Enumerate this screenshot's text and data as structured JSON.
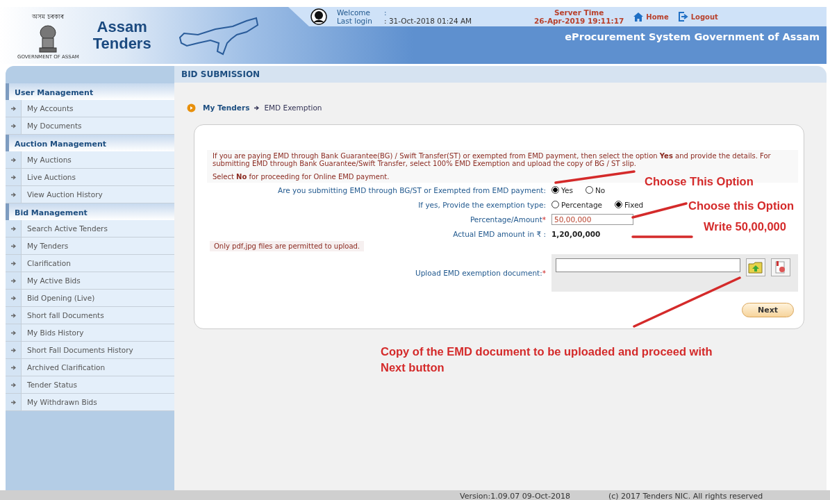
{
  "header": {
    "govt_script": "অসম চৰকাৰ",
    "govt_caption": "GOVERNMENT OF ASSAM",
    "site_title_lines": [
      "Assam",
      "Tenders"
    ],
    "welcome_label": "Welcome",
    "welcome_value": ":",
    "last_login_label": "Last login",
    "last_login_value": ": 31-Oct-2018 01:24 AM",
    "server_time_label": "Server Time",
    "server_time": "26-Apr-2019 19:11:17",
    "nav": [
      {
        "kind": "home",
        "label": "Home"
      },
      {
        "kind": "logout",
        "label": "Logout"
      }
    ],
    "system_title": "eProcurement System Government of Assam"
  },
  "sidebar": {
    "sections": [
      {
        "title": "User Management",
        "items": [
          "My Accounts",
          "My Documents"
        ]
      },
      {
        "title": "Auction Management",
        "items": [
          "My Auctions",
          "Live Auctions",
          "View Auction History"
        ]
      },
      {
        "title": "Bid Management",
        "items": [
          "Search Active Tenders",
          "My Tenders",
          "Clarification",
          "My Active Bids",
          "Bid Opening (Live)",
          "Short fall Documents",
          "My Bids History",
          "Short Fall Documents History",
          "Archived Clarification",
          "Tender Status",
          "My Withdrawn Bids"
        ]
      }
    ]
  },
  "page_title": "BID SUBMISSION",
  "breadcrumb": [
    "My Tenders",
    "EMD Exemption"
  ],
  "form": {
    "info_lines": [
      "If you are paying EMD through Bank Guarantee(BG) / Swift Transfer(ST) or exempted from EMD payment, then select the option **Yes** and provide the details. For submitting EMD through Bank Guarantee/Swift Transfer, select 100% EMD Exemption and upload the copy of BG / ST slip.",
      "Select **No** for proceeding for Online EMD payment."
    ],
    "radio_questions": [
      {
        "label": "Are you submitting EMD through BG/ST or Exempted from EMD payment:",
        "options": [
          {
            "label": "Yes",
            "selected": true
          },
          {
            "label": "No",
            "selected": false
          }
        ]
      },
      {
        "label": "If yes, Provide the exemption type:",
        "options": [
          {
            "label": "Percentage",
            "selected": false
          },
          {
            "label": "Fixed",
            "selected": true
          }
        ]
      }
    ],
    "amount": {
      "label": "Percentage/Amount",
      "required": "*",
      "value": "50,00,000"
    },
    "actual_emd": {
      "label": "Actual EMD amount in ₹ :",
      "value": "1,20,00,000"
    },
    "file_note": "Only pdf,jpg files are permitted to upload.",
    "upload": {
      "label": "Upload EMD exemption document:",
      "required": "*"
    },
    "next_button": "Next"
  },
  "annotations": [
    "Choose This Option",
    "Choose this Option",
    "Write 50,00,000",
    "Copy of the EMD document to be uploaded and proceed with Next button"
  ],
  "footer": {
    "version": "Version:1.09.07 09-Oct-2018",
    "copyright": "(c) 2017 Tenders NIC. All rights reserved"
  }
}
